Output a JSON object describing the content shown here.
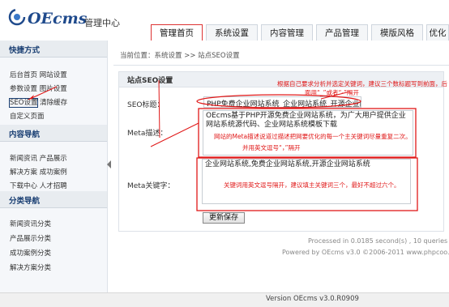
{
  "header": {
    "logo_text": "OEcms",
    "admin_title": "管理中心",
    "tabs": [
      {
        "label": "管理首页",
        "active": true
      },
      {
        "label": "系统设置",
        "active": false
      },
      {
        "label": "内容管理",
        "active": false
      },
      {
        "label": "产品管理",
        "active": false
      },
      {
        "label": "模版风格",
        "active": false
      },
      {
        "label": "优化",
        "active": false
      }
    ]
  },
  "sidebar": {
    "sections": [
      {
        "title": "快捷方式",
        "rows": [
          [
            "后台首页",
            "网站设置"
          ],
          [
            "参数设置",
            "图片设置"
          ],
          [
            "SEO设置",
            "清除缓存"
          ],
          [
            "自定义页面"
          ]
        ]
      },
      {
        "title": "内容导航",
        "rows": [
          [
            "新闻资讯",
            "产品展示"
          ],
          [
            "解决方案",
            "成功案例"
          ],
          [
            "下载中心",
            "人才招聘"
          ]
        ]
      },
      {
        "title": "分类导航",
        "rows": [
          [
            "新闻资讯分类"
          ],
          [
            "产品展示分类"
          ],
          [
            "成功案例分类"
          ],
          [
            "解决方案分类"
          ]
        ]
      }
    ]
  },
  "breadcrumb": "当前位置：系统设置 >> 站点SEO设置",
  "panel": {
    "title": "站点SEO设置",
    "seo_title_label": "SEO标题：",
    "seo_title_value": "PHP免费企业网站系统_企业网站系统_开源企业网",
    "meta_desc_label": "Meta描述：",
    "meta_desc_value": "OEcms基于PHP开源免费企业网站系统，为广大用户提供企业网站系统源代码、企业网站系统模板下载",
    "meta_kw_label": "Meta关键字：",
    "meta_kw_value": "企业网站系统,免费企业网站系统,开源企业网站系统",
    "save_label": "更新保存"
  },
  "annotations": {
    "title_note_1": "根据自己要求分析并选定关键词，建议三个数标题写到前面，后",
    "title_note_2": "面用“_”或者“-”隔开",
    "desc_note_1": "网站的Meta描述说道过描述把网要优化的每一个主关键词尽量重复二次。",
    "desc_note_2": "并用英文逗号“，”隔开",
    "kw_note": "关键词用英文逗号隔开，建议填主关键词三个，最好不超过六个。"
  },
  "footer": {
    "stats": "Processed in 0.0185 second(s) , 10 queries",
    "powered": "Powered by OEcms v3.0 ©2006-2011 www.phpcoo.com",
    "version": "Version OEcms v3.0.R0909"
  },
  "colors": {
    "brand": "#1f4a8c",
    "annotation": "#e01818",
    "section_title": "#1a3f73"
  },
  "icons": [
    "logo-swirl-icon",
    "collapse-arrow-icon"
  ]
}
